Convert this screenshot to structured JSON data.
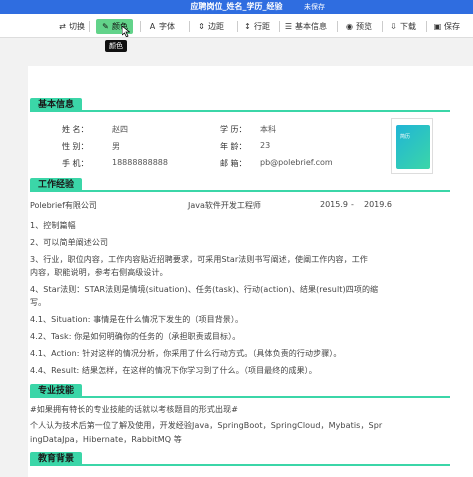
{
  "topbar": {
    "title": "应聘岗位_姓名_学历_经验",
    "user": "未保存"
  },
  "toolbar": {
    "items": [
      {
        "icon": "swap-icon",
        "glyph": "⇄",
        "label": "切换"
      },
      {
        "icon": "brush-icon",
        "glyph": "✎",
        "label": "颜色"
      },
      {
        "icon": "font-icon",
        "glyph": "A",
        "label": "字体"
      },
      {
        "icon": "spacing-icon",
        "glyph": "⇕",
        "label": "边距"
      },
      {
        "icon": "line-spacing-icon",
        "glyph": "↕",
        "label": "行距"
      },
      {
        "icon": "basic-info-icon",
        "glyph": "☰",
        "label": "基本信息"
      },
      {
        "icon": "preview-icon",
        "glyph": "◉",
        "label": "预览"
      },
      {
        "icon": "download-icon",
        "glyph": "⇩",
        "label": "下载"
      },
      {
        "icon": "save-icon",
        "glyph": "▣",
        "label": "保存"
      }
    ],
    "tooltip": "颜色"
  },
  "sections": {
    "basic": "基本信息",
    "work": "工作经验",
    "skills": "专业技能",
    "education": "教育背景"
  },
  "basic": {
    "name_label": "姓 名：",
    "name": "赵四",
    "gender_label": "性 别：",
    "gender": "男",
    "phone_label": "手 机：",
    "phone": "18888888888",
    "edu_label": "学 历：",
    "edu": "本科",
    "age_label": "年 龄：",
    "age": "23",
    "email_label": "邮 箱：",
    "email": "pb@polebrief.com",
    "photo_text": "简历"
  },
  "work": {
    "company": "Polebrief有限公司",
    "position": "Java软件开发工程师",
    "start": "2015.9",
    "dash": "-",
    "end": "2019.6",
    "lines": [
      "1、控制篇幅",
      "2、可以简单阐述公司",
      "3、行业，职位内容，工作内容贴近招聘要求，可采用Star法则书写阐述，使阐工作内容，工作",
      "内容，职能说明，参考右侧高级设计。",
      "4、Star法则：STAR法则是情境(situation)、任务(task)、行动(action)、结果(result)四项的缩",
      "写。",
      "4.1、Situation: 事情是在什么情况下发生的（项目背景）。",
      "4.2、Task: 你是如何明确你的任务的（承担职责或目标）。",
      "4.1、Action: 针对这样的情况分析，你采用了什么行动方式。（具体负责的行动步骤）。",
      "4.4、Result: 结果怎样，在这样的情况下你学习到了什么。（项目最终的成果）。"
    ]
  },
  "skills": {
    "lines": [
      "#如果拥有特长的专业技能的话就以考核题目的形式出现#",
      "个人认为技术后第一位了解及使用，开发经验Java，SpringBoot，SpringCloud，Mybatis，Spr",
      "ingDataJpa，Hibernate，RabbitMQ 等"
    ]
  }
}
